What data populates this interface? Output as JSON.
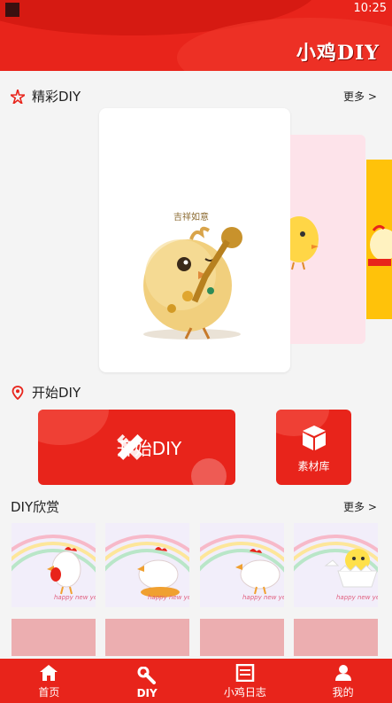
{
  "status_bar": {
    "time": "10:25"
  },
  "header": {
    "logo_text": "小鸡DIY"
  },
  "featured": {
    "title": "精彩DIY",
    "more": "更多 >",
    "card_text": "吉祥如意"
  },
  "start": {
    "title": "开始DIY",
    "start_button": "开始DIY",
    "library_button": "素材库"
  },
  "gallery": {
    "title": "DIY欣赏",
    "more": "更多 >",
    "caption": "happy new year"
  },
  "nav": {
    "items": [
      {
        "label": "首页",
        "icon": "home-icon"
      },
      {
        "label": "DIY",
        "icon": "wrench-icon"
      },
      {
        "label": "小鸡日志",
        "icon": "journal-icon"
      },
      {
        "label": "我的",
        "icon": "user-icon"
      }
    ],
    "active": "DIY"
  },
  "colors": {
    "brand": "#e8241b",
    "background": "#f4f4f4"
  }
}
